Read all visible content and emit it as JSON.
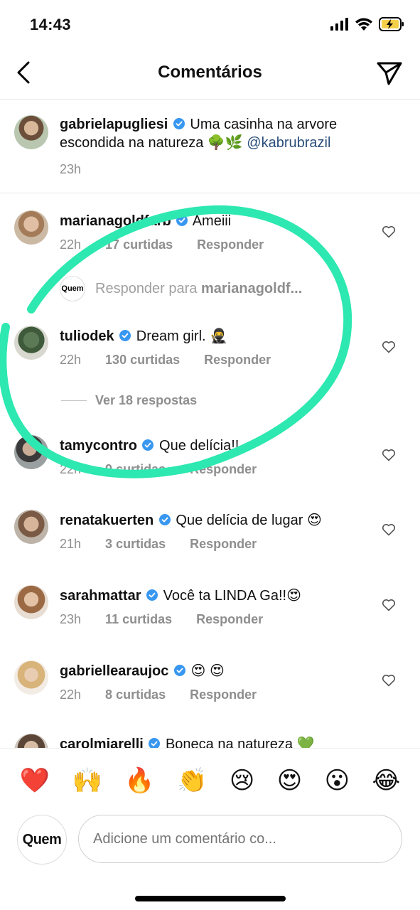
{
  "status_bar": {
    "time": "14:43"
  },
  "header": {
    "title": "Comentários"
  },
  "caption": {
    "username": "gabrielapugliesi",
    "text_line1": "Uma casinha na arvore",
    "text_line2": "escondida na natureza 🌳🌿",
    "mention": "@kabrubrazil",
    "age": "23h"
  },
  "comments": [
    {
      "username": "marianagoldfarb",
      "text": "Ameiii",
      "age": "22h",
      "likes": "17 curtidas",
      "reply": "Responder"
    },
    {
      "username": "tuliodek",
      "text": "Dream girl. 🥷",
      "age": "22h",
      "likes": "130 curtidas",
      "reply": "Responder"
    },
    {
      "username": "tamycontro",
      "text": "Que delícia!!",
      "age": "22h",
      "likes": "9 curtidas",
      "reply": "Responder"
    },
    {
      "username": "renatakuerten",
      "text": "Que delícia de lugar 😍",
      "age": "21h",
      "likes": "3 curtidas",
      "reply": "Responder"
    },
    {
      "username": "sarahmattar",
      "text": "Você ta LINDA Ga!!😍",
      "age": "23h",
      "likes": "11 curtidas",
      "reply": "Responder"
    },
    {
      "username": "gabriellearaujoc",
      "text": "😍 😍",
      "age": "22h",
      "likes": "8 curtidas",
      "reply": "Responder"
    },
    {
      "username": "carolmiarelli",
      "text": "Boneca na natureza 💚"
    }
  ],
  "reply_prompt": {
    "avatar_label": "Quem",
    "prefix": "Responder para",
    "target": "marianagoldf..."
  },
  "view_replies": "Ver 18 respostas",
  "emoji_bar": [
    "❤️",
    "🙌",
    "🔥",
    "👏",
    "😢",
    "😍",
    "😮",
    "😂"
  ],
  "compose": {
    "avatar_label": "Quem",
    "placeholder": "Adicione um comentário co..."
  },
  "colors": {
    "verified": "#3897f0",
    "annotation": "#2de8b0",
    "secondary_text": "#8e8e8e"
  }
}
